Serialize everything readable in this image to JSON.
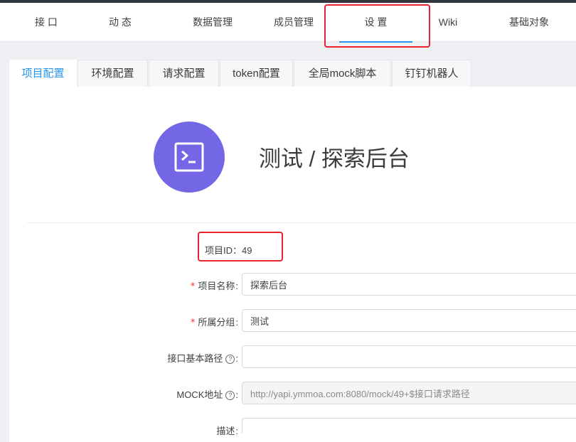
{
  "nav": {
    "items": [
      {
        "label": "接 口"
      },
      {
        "label": "动 态"
      },
      {
        "label": "数据管理"
      },
      {
        "label": "成员管理"
      },
      {
        "label": "设 置"
      },
      {
        "label": "Wiki"
      },
      {
        "label": "基础对象"
      }
    ],
    "active_index": 4
  },
  "tabs": [
    {
      "label": "项目配置"
    },
    {
      "label": "环境配置"
    },
    {
      "label": "请求配置"
    },
    {
      "label": "token配置"
    },
    {
      "label": "全局mock脚本"
    },
    {
      "label": "钉钉机器人"
    }
  ],
  "project": {
    "title": "测试 / 探索后台",
    "icon": "terminal-icon",
    "icon_bg": "#7467e6"
  },
  "form": {
    "id_label": "项目ID：",
    "id_value": "49",
    "name_label": "项目名称",
    "name_value": "探索后台",
    "group_label": "所属分组",
    "group_value": "测试",
    "basepath_label": "接口基本路径",
    "basepath_value": "",
    "mock_label": "MOCK地址",
    "mock_value": "http://yapi.ymmoa.com:8080/mock/49+$接口请求路径",
    "desc_label": "描述"
  },
  "colors": {
    "accent": "#2395f1",
    "highlight": "#e8232b",
    "required": "#f0372c"
  }
}
